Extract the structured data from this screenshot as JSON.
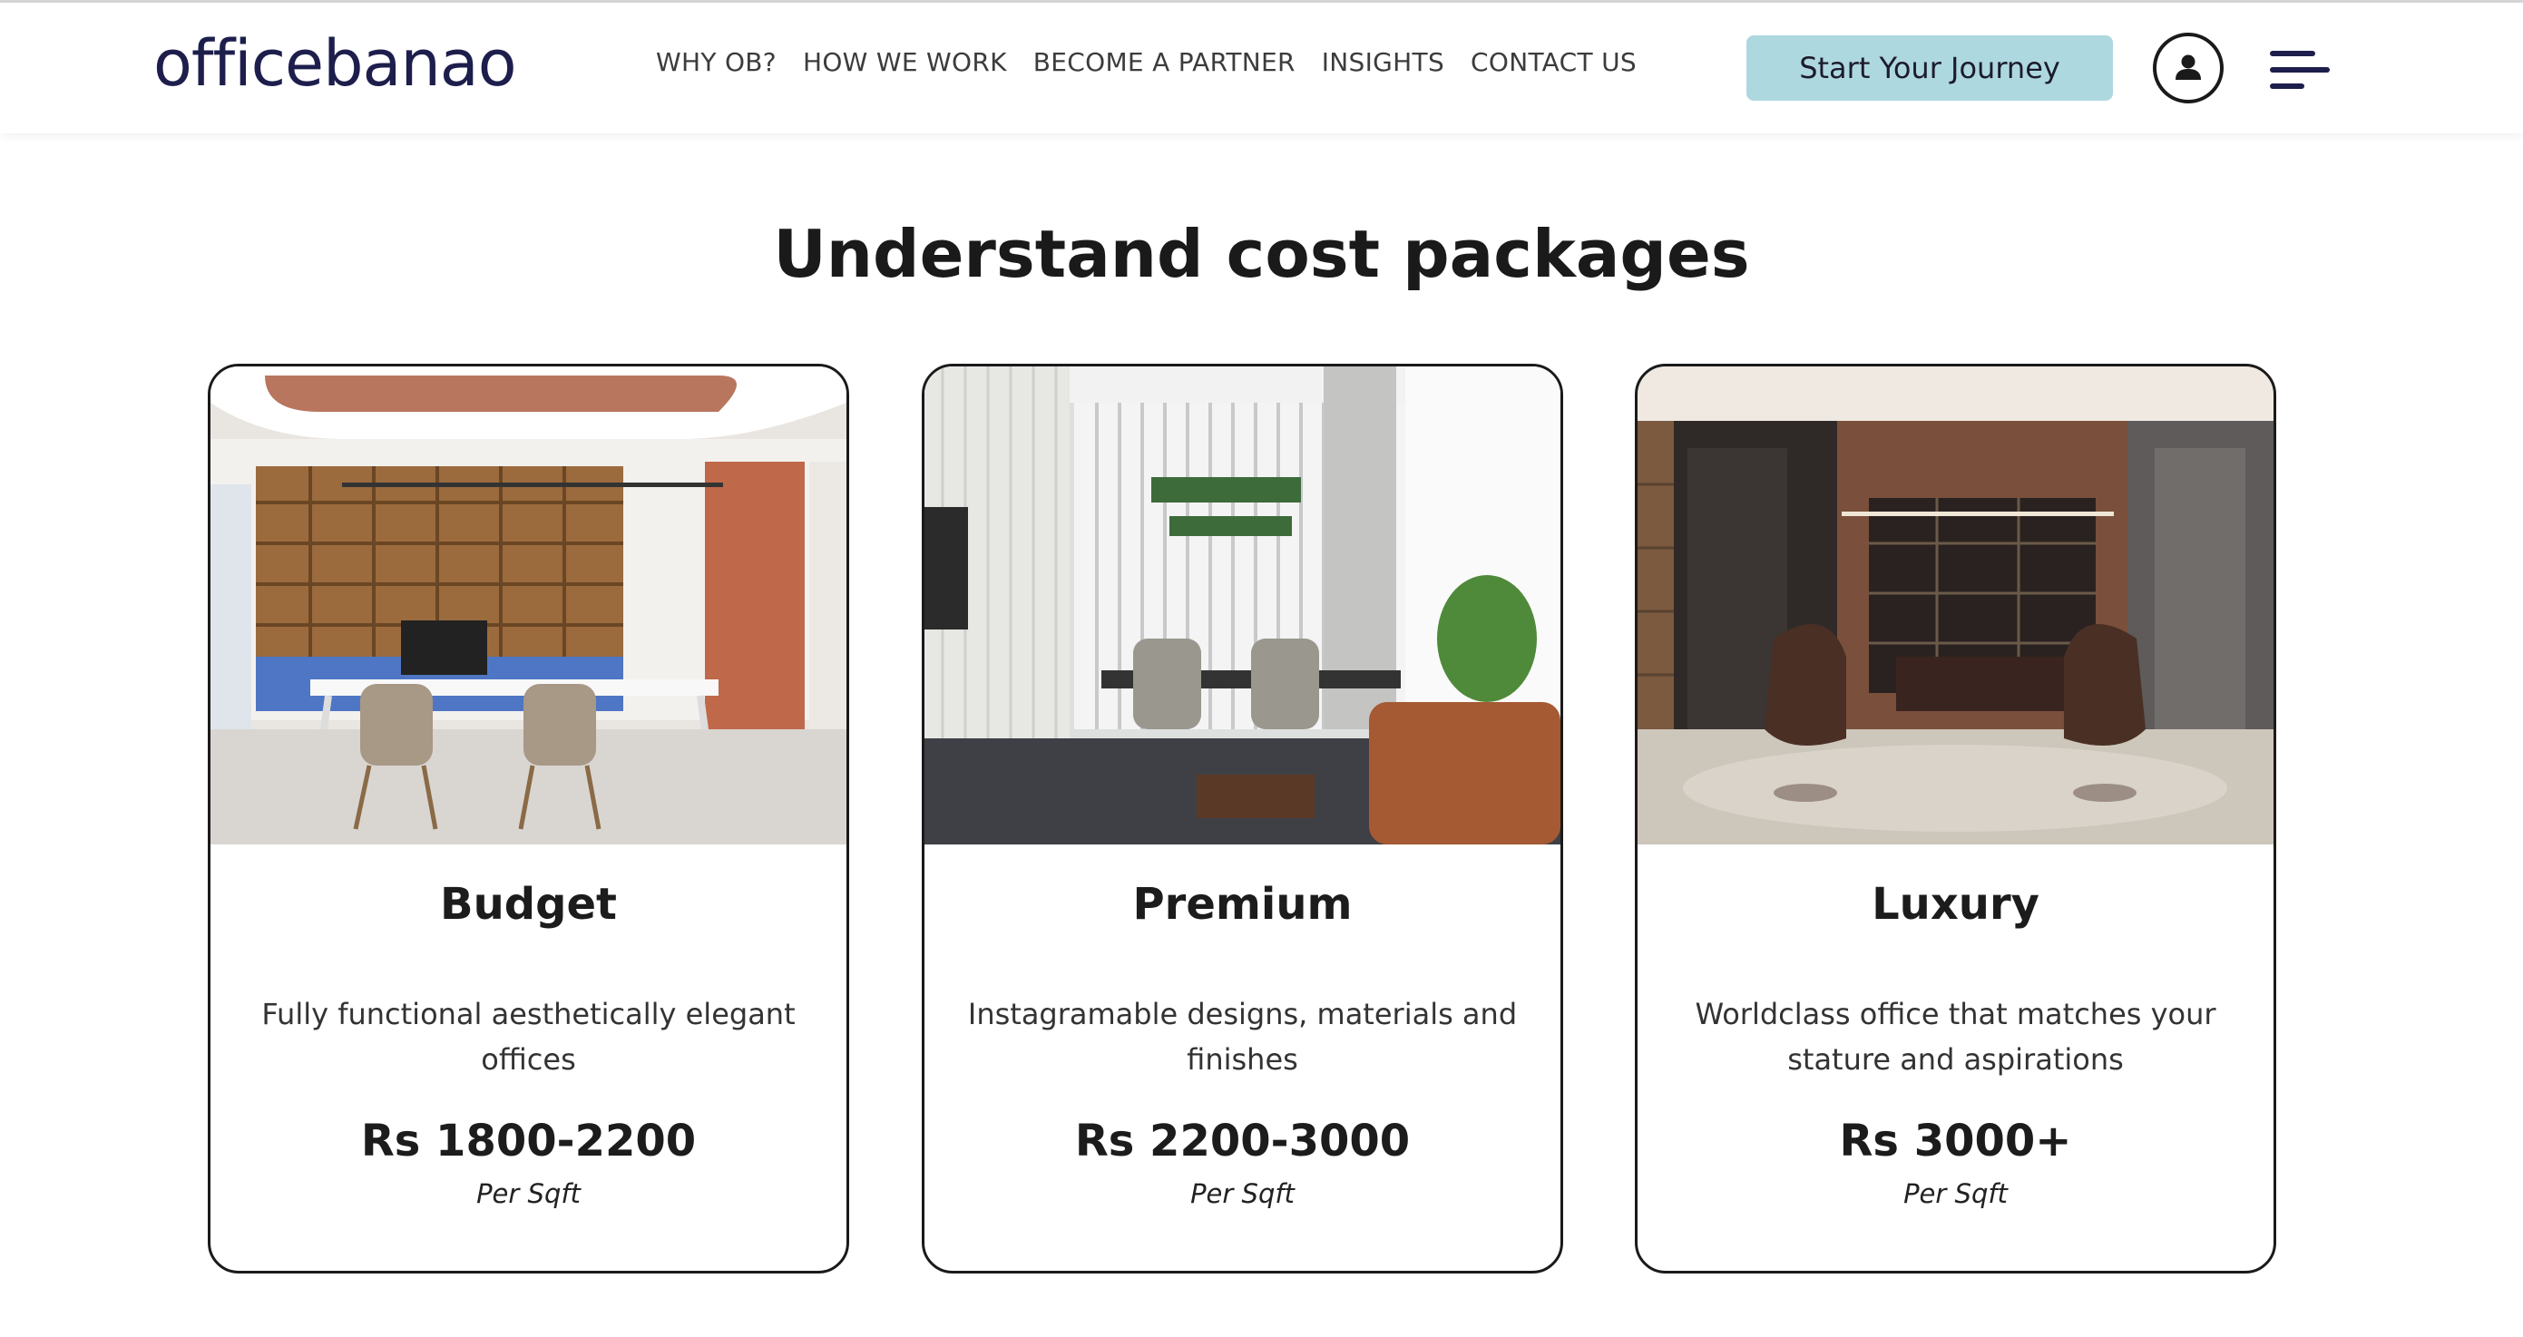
{
  "header": {
    "logo_text": "officebanao",
    "nav": [
      "WHY OB?",
      "HOW WE WORK",
      "BECOME A PARTNER",
      "INSIGHTS",
      "CONTACT US"
    ],
    "cta_label": "Start Your Journey",
    "icons": {
      "user": "user-icon",
      "menu": "menu-icon"
    }
  },
  "section": {
    "title_bold": "Understand",
    "title_rest": " cost packages"
  },
  "cards": [
    {
      "title": "Budget",
      "description": "Fully functional aesthetically elegant offices",
      "price": "Rs 1800-2200",
      "unit": "Per Sqft"
    },
    {
      "title": "Premium",
      "description": "Instagramable designs, materials and finishes",
      "price": "Rs 2200-3000",
      "unit": "Per Sqft"
    },
    {
      "title": "Luxury",
      "description": "Worldclass office that matches your stature and aspirations",
      "price": "Rs 3000+",
      "unit": "Per Sqft"
    }
  ],
  "colors": {
    "brand_navy": "#1d1e4c",
    "cta_bg": "#aed8e0",
    "card_border": "#1a1a1a"
  }
}
